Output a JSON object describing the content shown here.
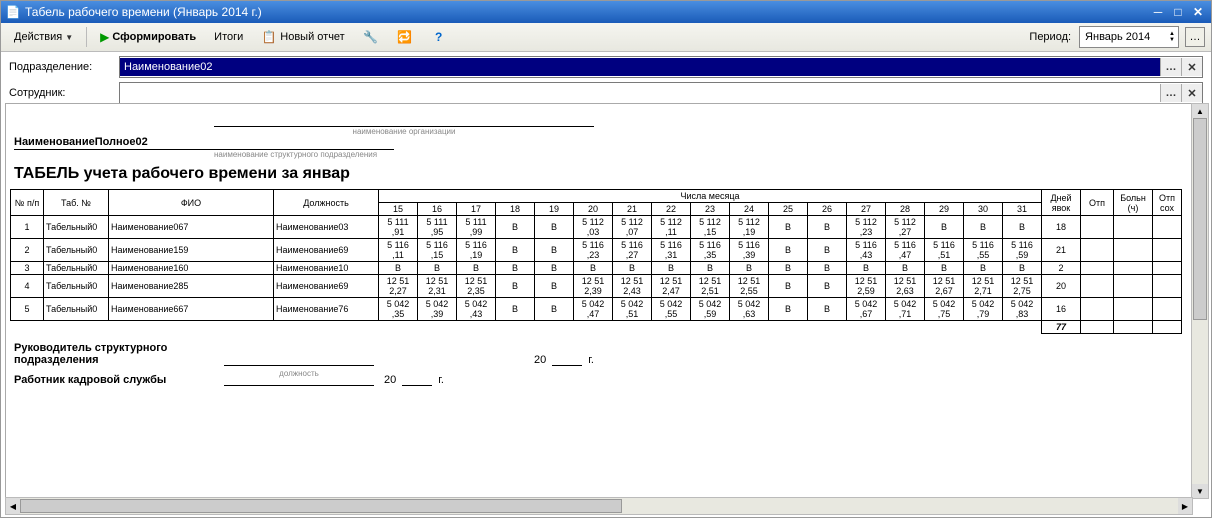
{
  "window": {
    "title": "Табель рабочего времени (Январь 2014 г.)"
  },
  "toolbar": {
    "actions": "Действия",
    "form": "Сформировать",
    "totals": "Итоги",
    "new_report": "Новый отчет",
    "period_label": "Период:",
    "period_value": "Январь 2014"
  },
  "filters": {
    "dept_label": "Подразделение:",
    "dept_value": "Наименование02",
    "emp_label": "Сотрудник:",
    "emp_value": ""
  },
  "report": {
    "org_caption": "наименование организации",
    "full_name": "НаименованиеПолное02",
    "dept_caption": "наименование структурного подразделения",
    "title": "ТАБЕЛЬ учета рабочего времени за январ",
    "col_num": "№ п/п",
    "col_tab": "Таб. №",
    "col_fio": "ФИО",
    "col_pos": "Должность",
    "col_days_group": "Числа месяца",
    "days": [
      "15",
      "16",
      "17",
      "18",
      "19",
      "20",
      "21",
      "22",
      "23",
      "24",
      "25",
      "26",
      "27",
      "28",
      "29",
      "30",
      "31"
    ],
    "col_attend": "Дней явок",
    "col_otp": "Отп",
    "col_sick": "Больн (ч)",
    "col_otg": "Отп сох",
    "rows": [
      {
        "n": "1",
        "tab": "Табельный0",
        "fio": "Наименование067",
        "pos": "Наименование03",
        "cells": [
          "5 111\n,91",
          "5 111\n,95",
          "5 111\n,99",
          "В",
          "В",
          "5 112\n,03",
          "5 112\n,07",
          "5 112\n,11",
          "5 112\n,15",
          "5 112\n,19",
          "В",
          "В",
          "5 112\n,23",
          "5 112\n,27",
          "В",
          "В",
          "В"
        ],
        "att": "18"
      },
      {
        "n": "2",
        "tab": "Табельный0",
        "fio": "Наименование159",
        "pos": "Наименование69",
        "cells": [
          "5 116\n,11",
          "5 116\n,15",
          "5 116\n,19",
          "В",
          "В",
          "5 116\n,23",
          "5 116\n,27",
          "5 116\n,31",
          "5 116\n,35",
          "5 116\n,39",
          "В",
          "В",
          "5 116\n,43",
          "5 116\n,47",
          "5 116\n,51",
          "5 116\n,55",
          "5 116\n,59"
        ],
        "att": "21"
      },
      {
        "n": "3",
        "tab": "Табельный0",
        "fio": "Наименование160",
        "pos": "Наименование10",
        "cells": [
          "В",
          "В",
          "В",
          "В",
          "В",
          "В",
          "В",
          "В",
          "В",
          "В",
          "В",
          "В",
          "В",
          "В",
          "В",
          "В",
          "В"
        ],
        "att": "2"
      },
      {
        "n": "4",
        "tab": "Табельный0",
        "fio": "Наименование285",
        "pos": "Наименование69",
        "cells": [
          "12 51\n2,27",
          "12 51\n2,31",
          "12 51\n2,35",
          "В",
          "В",
          "12 51\n2,39",
          "12 51\n2,43",
          "12 51\n2,47",
          "12 51\n2,51",
          "12 51\n2,55",
          "В",
          "В",
          "12 51\n2,59",
          "12 51\n2,63",
          "12 51\n2,67",
          "12 51\n2,71",
          "12 51\n2,75"
        ],
        "att": "20"
      },
      {
        "n": "5",
        "tab": "Табельный0",
        "fio": "Наименование667",
        "pos": "Наименование76",
        "cells": [
          "5 042\n,35",
          "5 042\n,39",
          "5 042\n,43",
          "В",
          "В",
          "5 042\n,47",
          "5 042\n,51",
          "5 042\n,55",
          "5 042\n,59",
          "5 042\n,63",
          "В",
          "В",
          "5 042\n,67",
          "5 042\n,71",
          "5 042\n,75",
          "5 042\n,79",
          "5 042\n,83"
        ],
        "att": "16"
      }
    ],
    "total_att": "77",
    "sign_head": "Руководитель структурного подразделения",
    "sign_hr": "Работник кадровой службы",
    "sign_pos_cap": "должность",
    "year_prefix": "20",
    "year_suffix": "г."
  }
}
